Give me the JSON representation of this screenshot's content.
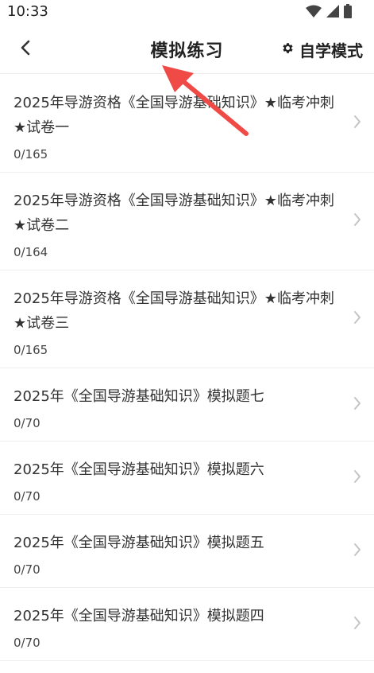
{
  "status_bar": {
    "time": "10:33",
    "icons": [
      "wifi-icon",
      "signal-icon",
      "battery-icon"
    ]
  },
  "header": {
    "title": "模拟练习",
    "back_icon": "chevron-left-icon",
    "mode_button": {
      "icon": "gear-icon",
      "label": "自学模式"
    }
  },
  "annotation": {
    "type": "red-arrow",
    "color": "#f04a47",
    "points_to": "page-title"
  },
  "exercises": [
    {
      "title": "2025年导游资格《全国导游基础知识》★临考冲刺★试卷一",
      "progress": "0/165"
    },
    {
      "title": "2025年导游资格《全国导游基础知识》★临考冲刺★试卷二",
      "progress": "0/164"
    },
    {
      "title": "2025年导游资格《全国导游基础知识》★临考冲刺★试卷三",
      "progress": "0/165"
    },
    {
      "title": "2025年《全国导游基础知识》模拟题七",
      "progress": "0/70"
    },
    {
      "title": "2025年《全国导游基础知识》模拟题六",
      "progress": "0/70"
    },
    {
      "title": "2025年《全国导游基础知识》模拟题五",
      "progress": "0/70"
    },
    {
      "title": "2025年《全国导游基础知识》模拟题四",
      "progress": "0/70"
    }
  ],
  "colors": {
    "accent_arrow": "#f04a47",
    "text": "#333333",
    "divider": "#eeeeee",
    "chevron": "#c4c4c4"
  }
}
